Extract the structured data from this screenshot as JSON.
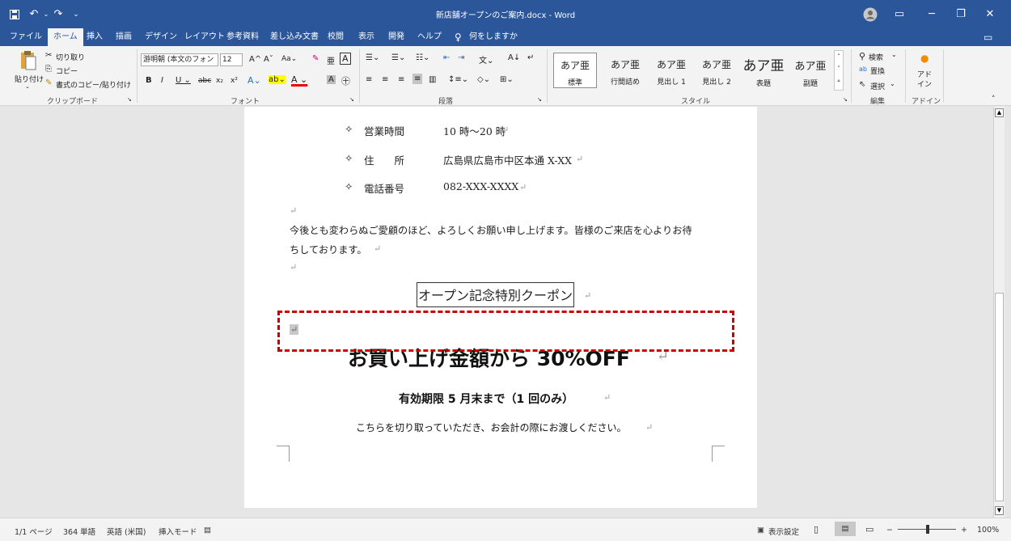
{
  "titlebar": {
    "title": "新店舗オープンのご案内.docx - Word",
    "undo_label": "↶",
    "redo_label": "↷",
    "account_icon": "person-icon",
    "ribbon_display_label": "▭",
    "minimize_label": "─",
    "restore_label": "❐",
    "close_label": "✕"
  },
  "menu": {
    "items": [
      "ファイル",
      "ホーム",
      "挿入",
      "描画",
      "デザイン",
      "レイアウト",
      "参考資料",
      "差し込み文書",
      "校閲",
      "表示",
      "開発",
      "ヘルプ"
    ],
    "active": "ホーム",
    "tell_me": "何をしますか"
  },
  "ribbon": {
    "clipboard": {
      "paste": "貼り付け",
      "cut": "切り取り",
      "copy": "コピー",
      "format_painter": "書式のコピー/貼り付け",
      "group_label": "クリップボード"
    },
    "font": {
      "font_name": "游明朝 (本文のフォン",
      "font_size": "12",
      "group_label": "フォント"
    },
    "paragraph": {
      "group_label": "段落"
    },
    "styles": {
      "items": [
        {
          "sample": "あア亜",
          "name": "標準"
        },
        {
          "sample": "あア亜",
          "name": "行間詰め"
        },
        {
          "sample": "あア亜",
          "name": "見出し 1"
        },
        {
          "sample": "あア亜",
          "name": "見出し 2"
        },
        {
          "sample": "あア亜",
          "name": "表題"
        },
        {
          "sample": "あア亜",
          "name": "副題"
        }
      ],
      "group_label": "スタイル"
    },
    "editing": {
      "find": "検索",
      "replace": "置換",
      "select": "選択",
      "group_label": "編集"
    },
    "addins": {
      "label": "アド\nイン",
      "group_label": "アドイン"
    }
  },
  "document": {
    "info_rows": [
      {
        "label": "営業時間",
        "value": "10 時～20 時"
      },
      {
        "label": "住　　所",
        "value": "広島県広島市中区本通 X-XX"
      },
      {
        "label": "電話番号",
        "value": "082-XXX-XXXX"
      }
    ],
    "bullet": "✧",
    "body_line1": "今後とも変わらぬご愛顧のほど、よろしくお願い申し上げます。皆様のご来店を心よりお待",
    "body_line2": "ちしております。",
    "coupon_title": "オープン記念特別クーポン",
    "coupon_headline": "お買い上げ金額から 30%OFF",
    "coupon_validity": "有効期限 5 月末まで（1 回のみ）",
    "coupon_note": "こちらを切り取っていただき、お会計の際にお渡しください。",
    "para_mark": "↵"
  },
  "status": {
    "page": "1/1 ページ",
    "words": "364 単語",
    "language": "英語 (米国)",
    "mode": "挿入モード",
    "display_settings": "表示設定",
    "zoom": "100%"
  },
  "colors": {
    "accent": "#2b579a",
    "highlight_box": "#cc0000"
  }
}
